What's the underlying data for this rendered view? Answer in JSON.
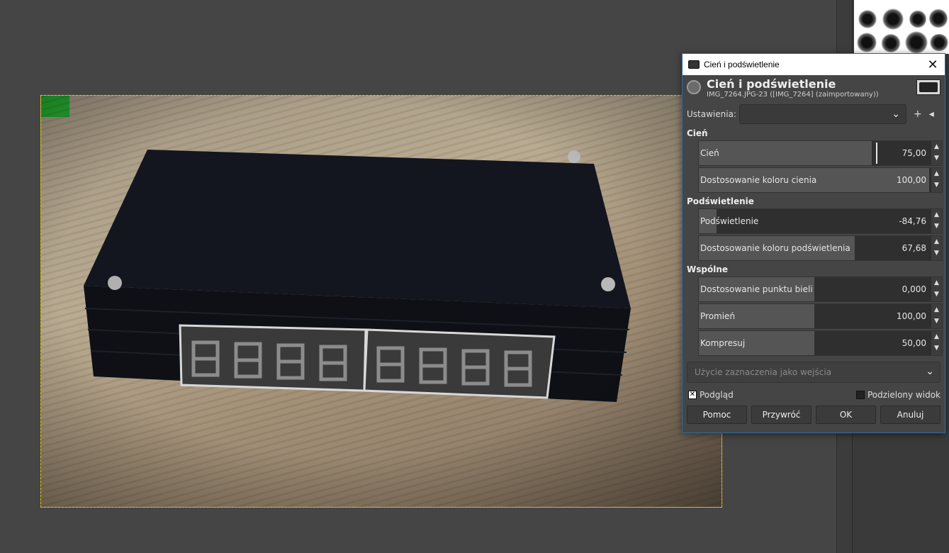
{
  "dialog": {
    "window_title": "Cień i podświetlenie",
    "close_label": "✕",
    "header_title": "Cień i podświetlenie",
    "header_subtitle": "IMG_7264.JPG-23 ([IMG_7264] (zaimportowany))",
    "presets_label": "Ustawienia:",
    "presets_value": "",
    "add_preset_icon": "+",
    "manage_preset_icon": "◂",
    "sections": {
      "shadows": "Cień",
      "highlights": "Podświetlenie",
      "common": "Wspólne"
    },
    "sliders": {
      "shadows": {
        "label": "Cień",
        "value": "75,00",
        "fraction": 0.75
      },
      "shadow_color": {
        "label": "Dostosowanie koloru cienia",
        "value": "100,00",
        "fraction": 1.0
      },
      "highlights": {
        "label": "Podświetlenie",
        "value": "-84,76",
        "fraction": 0.076
      },
      "highlight_color": {
        "label": "Dostosowanie koloru podświetlenia",
        "value": "67,68",
        "fraction": 0.6768
      },
      "white_point": {
        "label": "Dostosowanie punktu bieli",
        "value": "0,000",
        "fraction": 0.5
      },
      "radius": {
        "label": "Promień",
        "value": "100,00",
        "fraction": 0.5
      },
      "compress": {
        "label": "Kompresuj",
        "value": "50,00",
        "fraction": 0.5
      }
    },
    "input_selection_label": "Użycie zaznaczenia jako wejścia",
    "preview_label": "Podgląd",
    "preview_checked": true,
    "split_view_label": "Podzielony widok",
    "split_view_checked": false,
    "buttons": {
      "help": "Pomoc",
      "reset": "Przywróć",
      "ok": "OK",
      "cancel": "Anuluj"
    }
  },
  "colors": {
    "accent_border": "#2b6ca8",
    "selection_border": "#d8c800"
  }
}
